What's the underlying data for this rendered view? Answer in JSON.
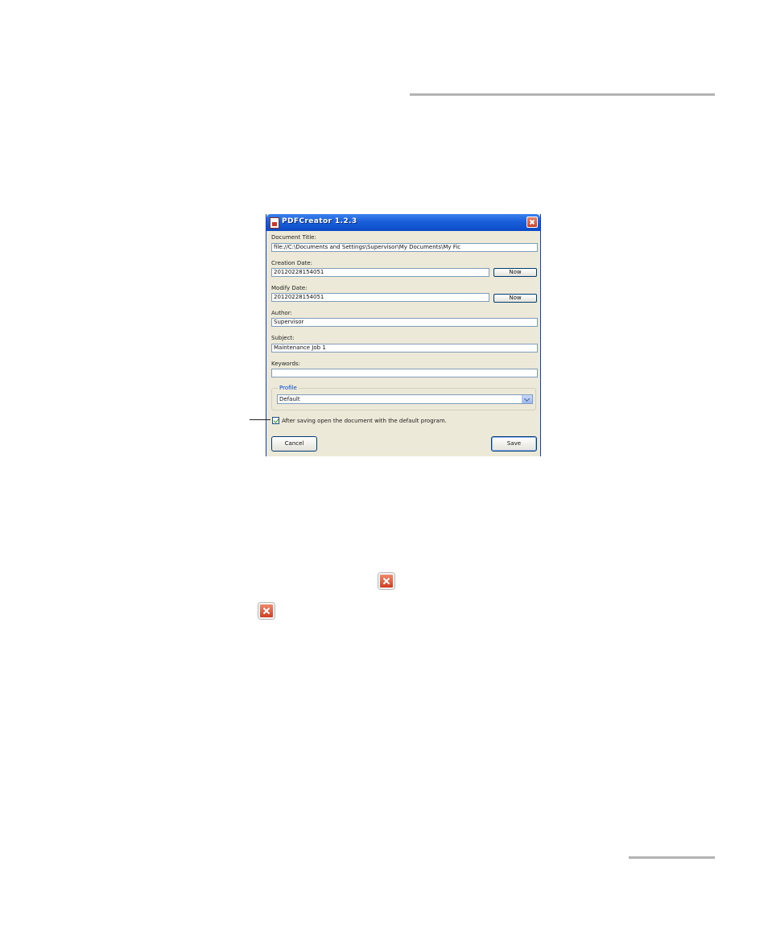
{
  "dialog": {
    "title": "PDFCreator 1.2.3",
    "document_title_label": "Document Title:",
    "document_title_value": "file://C:\\Documents and Settings\\Supervisor\\My Documents\\My Fic",
    "creation_date_label": "Creation Date:",
    "creation_date_value": "20120228154051",
    "modify_date_label": "Modify Date:",
    "modify_date_value": "20120228154051",
    "now_label": "Now",
    "author_label": "Author:",
    "author_value": "Supervisor",
    "subject_label": "Subject:",
    "subject_value": "Maintenance Job 1",
    "keywords_label": "Keywords:",
    "keywords_value": "",
    "profile_legend": "Profile",
    "profile_selected": "Default",
    "open_after_save_label": "After saving open the document with the default program.",
    "open_after_save_checked": true,
    "cancel_label": "Cancel",
    "save_label": "Save"
  },
  "icons": [
    "window-close-icon",
    "pdfcreator-app-icon",
    "checkmark-icon",
    "chevron-down-icon",
    "close-button-icon"
  ],
  "colors": {
    "titlebar": "#1a5fd9",
    "dialog_bg": "#ece9d8",
    "close_red": "#d4502f",
    "rule_gray": "#b3b3b3"
  }
}
